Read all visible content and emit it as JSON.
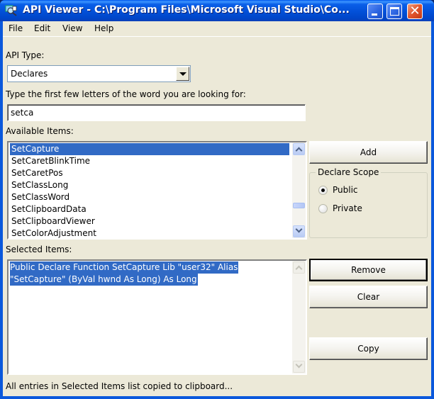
{
  "window": {
    "title": "API Viewer - C:\\Program Files\\Microsoft Visual Studio\\Co...",
    "controls": {
      "minimize": "minimize",
      "maximize": "maximize",
      "close": "close"
    }
  },
  "menu": {
    "items": [
      {
        "label": "File"
      },
      {
        "label": "Edit"
      },
      {
        "label": "View"
      },
      {
        "label": "Help"
      }
    ]
  },
  "api_type": {
    "label": "API Type:",
    "selected": "Declares"
  },
  "search": {
    "label": "Type the first few letters of the word you are looking for:",
    "value": "setca"
  },
  "available": {
    "label": "Available Items:",
    "items": [
      {
        "label": "SetCapture",
        "selected": true
      },
      {
        "label": "SetCaretBlinkTime",
        "selected": false
      },
      {
        "label": "SetCaretPos",
        "selected": false
      },
      {
        "label": "SetClassLong",
        "selected": false
      },
      {
        "label": "SetClassWord",
        "selected": false
      },
      {
        "label": "SetClipboardData",
        "selected": false
      },
      {
        "label": "SetClipboardViewer",
        "selected": false
      },
      {
        "label": "SetColorAdjustment",
        "selected": false
      }
    ]
  },
  "buttons": {
    "add": "Add",
    "remove": "Remove",
    "clear": "Clear",
    "copy": "Copy"
  },
  "declare_scope": {
    "legend": "Declare Scope",
    "options": [
      {
        "label": "Public",
        "checked": true
      },
      {
        "label": "Private",
        "checked": false
      }
    ]
  },
  "selected_items": {
    "label": "Selected Items:",
    "lines": [
      "Public Declare Function SetCapture Lib \"user32\" Alias",
      "\"SetCapture\" (ByVal hwnd As Long) As Long"
    ]
  },
  "status": {
    "text": "All entries in Selected Items list copied to clipboard..."
  },
  "colors": {
    "selection": "#316ac5",
    "titlebar": "#0a58dc",
    "client_bg": "#ece9d8"
  }
}
